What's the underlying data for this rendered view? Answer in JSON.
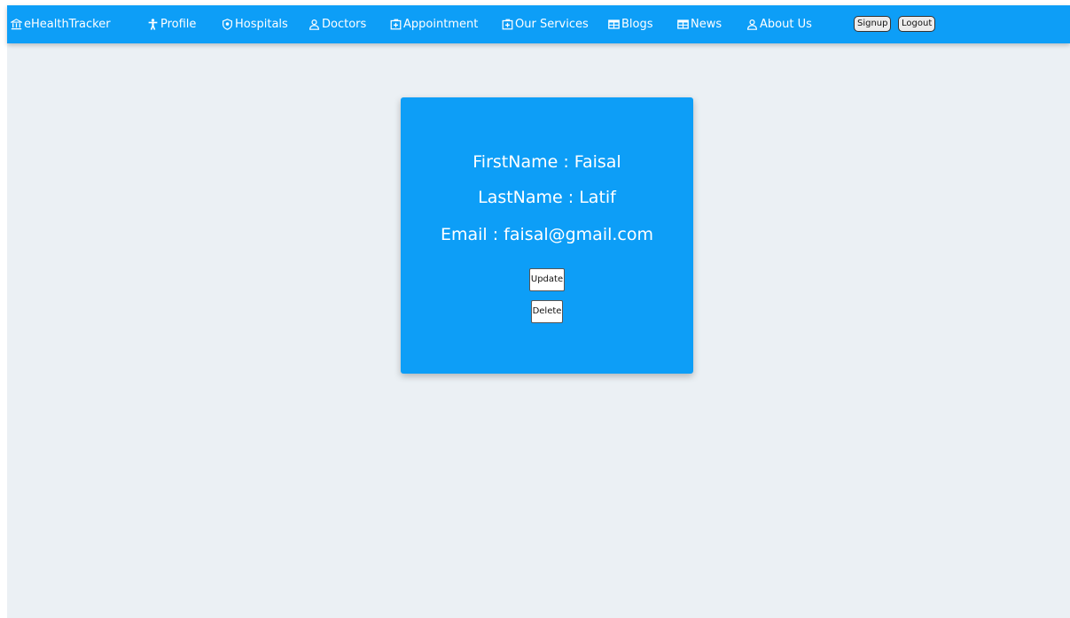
{
  "nav": {
    "brand": {
      "label": "eHealthTracker",
      "icon": "bank-icon"
    },
    "items": [
      {
        "label": "Profile",
        "icon": "person-icon"
      },
      {
        "label": "Hospitals",
        "icon": "shield-icon"
      },
      {
        "label": "Doctors",
        "icon": "user-icon"
      },
      {
        "label": "Appointment",
        "icon": "plus-box-icon"
      },
      {
        "label": "Our Services",
        "icon": "plus-box-icon"
      },
      {
        "label": "Blogs",
        "icon": "table-icon"
      },
      {
        "label": "News",
        "icon": "table-icon"
      },
      {
        "label": "About Us",
        "icon": "user-icon"
      }
    ],
    "signup_label": "Signup",
    "logout_label": "Logout"
  },
  "profile": {
    "first_name": "FirstName : Faisal",
    "last_name": "LastName : Latif",
    "email": "Email : faisal@gmail.com",
    "update_label": "Update",
    "delete_label": "Delete"
  },
  "colors": {
    "primary": "#0d9ef7",
    "background": "#ebf0f4"
  }
}
